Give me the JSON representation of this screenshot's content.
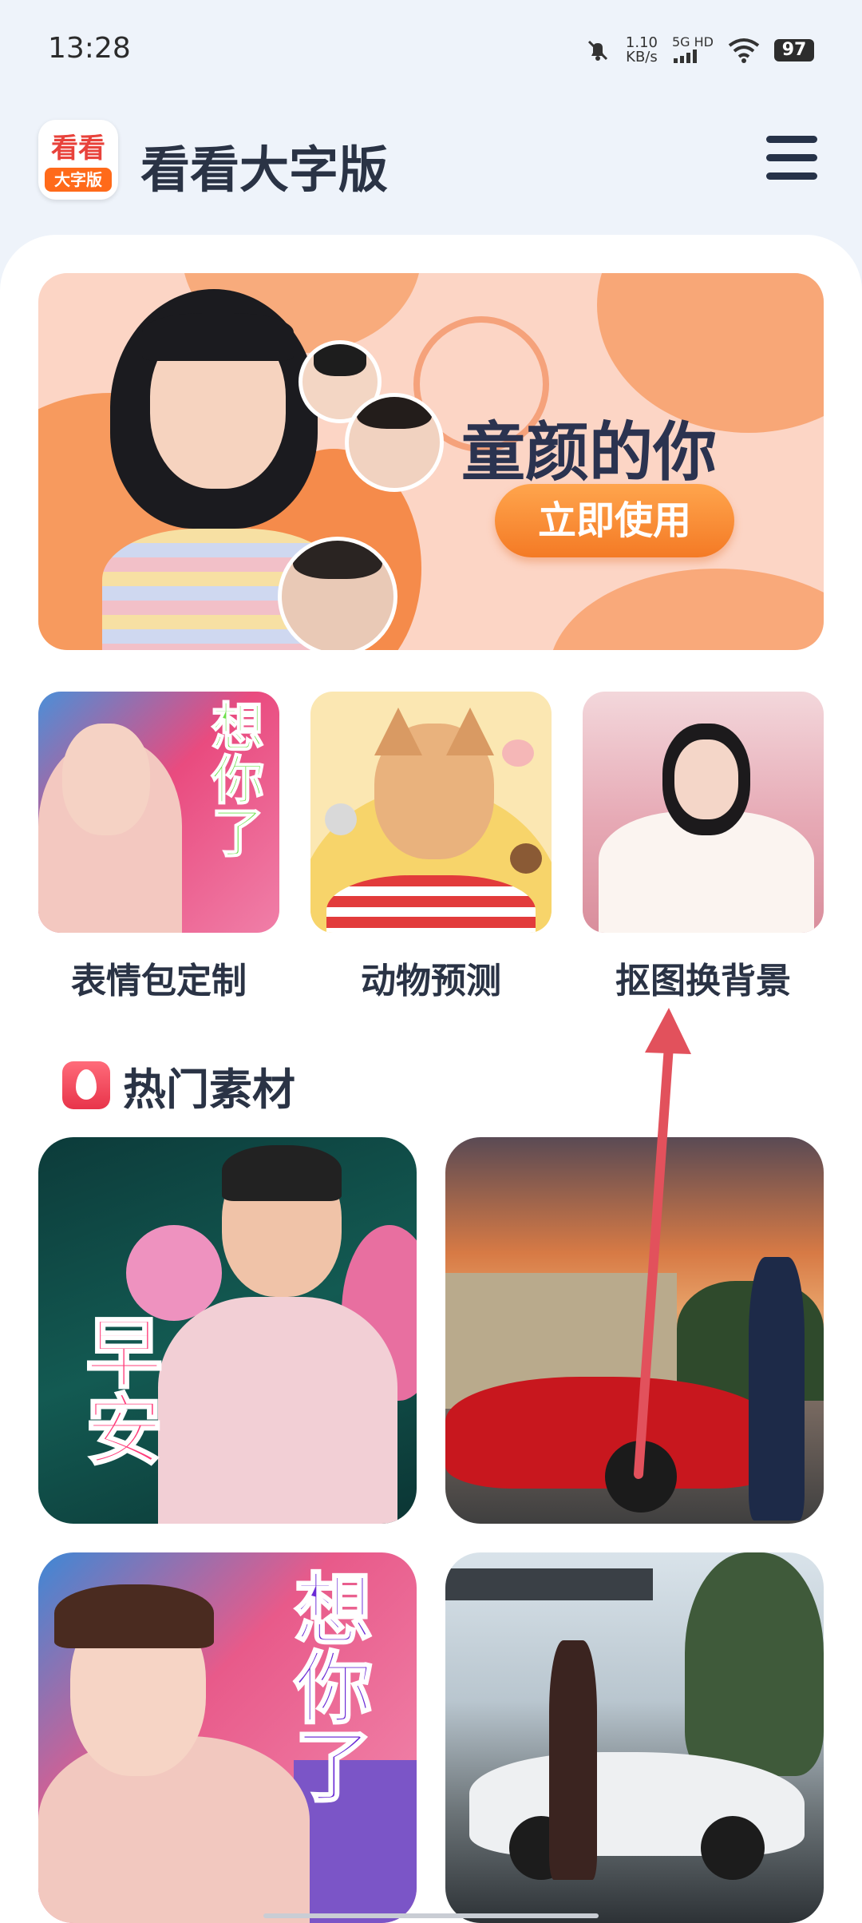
{
  "status_bar": {
    "time": "13:28",
    "net_speed_value": "1.10",
    "net_speed_unit": "KB/s",
    "network_type": "5G HD",
    "battery": "97"
  },
  "header": {
    "logo_top": "看看",
    "logo_bottom": "大字版",
    "title": "看看大字版",
    "menu_icon": "hamburger-menu-icon"
  },
  "banner": {
    "title": "童颜的你",
    "button": "立即使用",
    "accent": "#f47a25"
  },
  "features": [
    {
      "label": "表情包定制",
      "overlay": "想你了"
    },
    {
      "label": "动物预测"
    },
    {
      "label": "抠图换背景"
    }
  ],
  "hot_section": {
    "title": "热门素材",
    "icon": "flame-icon"
  },
  "materials": [
    {
      "overlay": "早安"
    },
    {
      "overlay": ""
    },
    {
      "overlay": "想你了"
    },
    {
      "overlay": ""
    }
  ]
}
